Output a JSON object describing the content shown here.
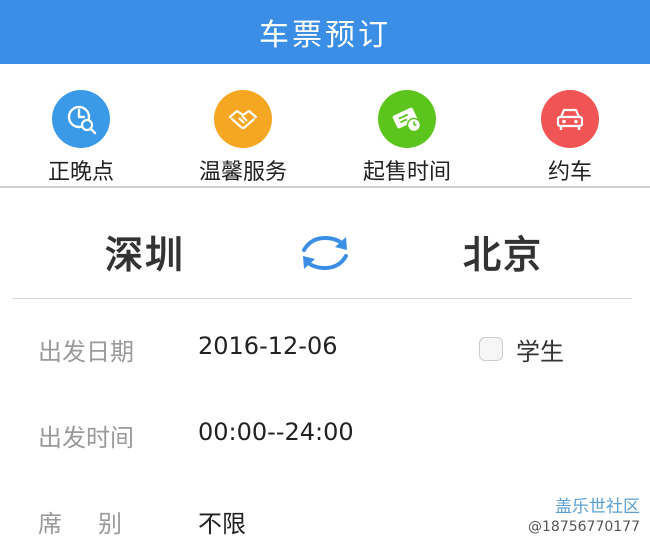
{
  "header": {
    "title": "车票预订"
  },
  "quick_actions": [
    {
      "label": "正晚点",
      "icon": "clock-search-icon",
      "color": "#3a9ae8"
    },
    {
      "label": "温馨服务",
      "icon": "handshake-icon",
      "color": "#f5a623"
    },
    {
      "label": "起售时间",
      "icon": "ticket-clock-icon",
      "color": "#5cc51d"
    },
    {
      "label": "约车",
      "icon": "car-icon",
      "color": "#f05454"
    }
  ],
  "route": {
    "from": "深圳",
    "to": "北京",
    "swap_icon": "swap-arrows-icon"
  },
  "form": {
    "date": {
      "label": "出发日期",
      "value": "2016-12-06"
    },
    "time": {
      "label": "出发时间",
      "value": "00:00--24:00"
    },
    "seat": {
      "label": "席别",
      "value": "不限"
    },
    "student": {
      "label": "学生",
      "checked": false
    }
  },
  "watermark": {
    "brand": "盖乐世社区",
    "handle": "@18756770177"
  },
  "colors": {
    "header_bg": "#3a8ee6",
    "swap_arrows": "#3a8ee6",
    "label_gray": "#9a9a9a"
  }
}
